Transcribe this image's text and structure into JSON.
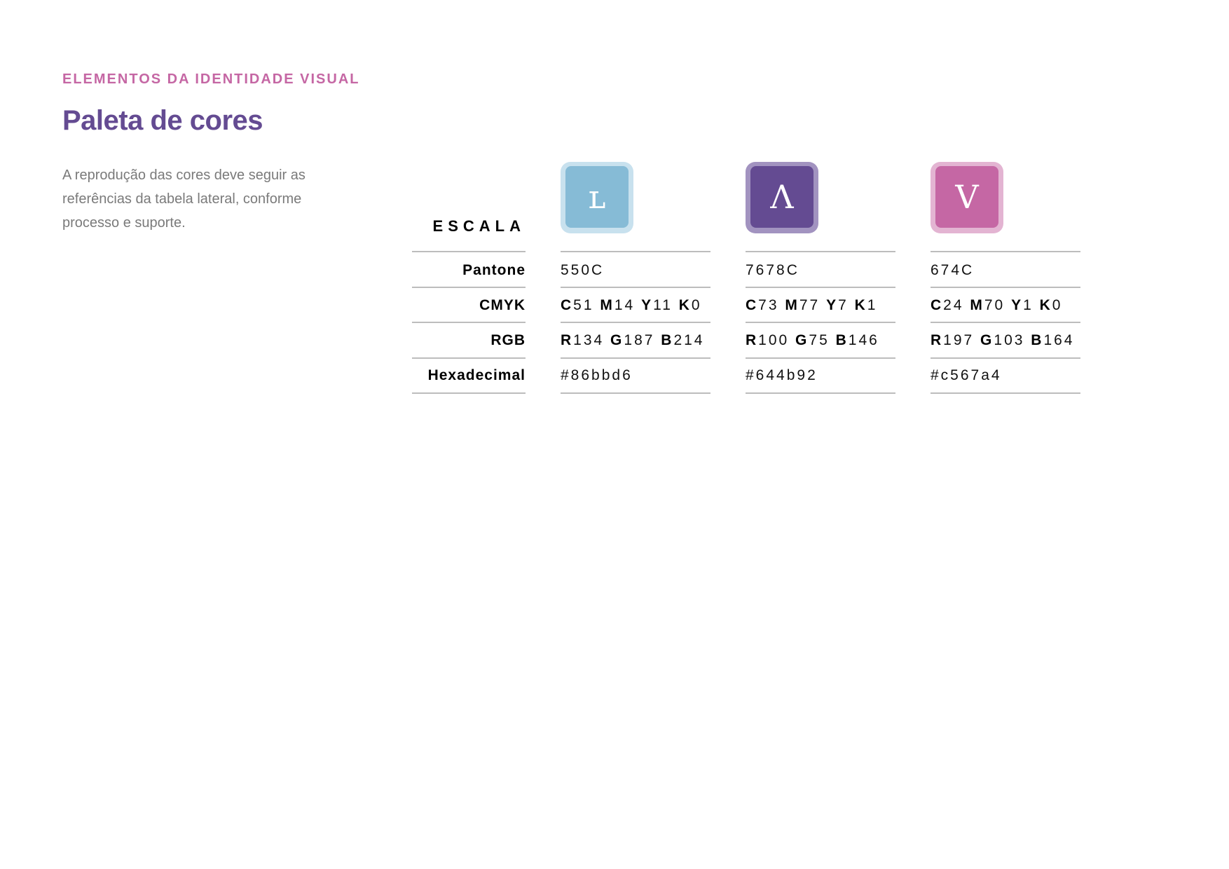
{
  "header": {
    "eyebrow": "ELEMENTOS DA IDENTIDADE VISUAL",
    "title": "Paleta de cores",
    "description": "A reprodução das cores deve seguir as referências da tabela lateral, conforme processo e suporte."
  },
  "table": {
    "scale_label": "ESCALA",
    "row_labels": {
      "pantone": "Pantone",
      "cmyk": "CMYK",
      "rgb": "RGB",
      "hex": "Hexadecimal"
    },
    "colors": [
      {
        "glyph": "ʟ",
        "swatch_color": "#86bbd6",
        "swatch_border": "#c8e1ee",
        "pantone": "550C",
        "cmyk": {
          "c": "51",
          "m": "14",
          "y": "11",
          "k": "0"
        },
        "rgb": {
          "r": "134",
          "g": "187",
          "b": "214"
        },
        "hex": "#86bbd6"
      },
      {
        "glyph": "Λ",
        "swatch_color": "#644b92",
        "swatch_border": "#a293c0",
        "pantone": "7678C",
        "cmyk": {
          "c": "73",
          "m": "77",
          "y": "7",
          "k": "1"
        },
        "rgb": {
          "r": "100",
          "g": "75",
          "b": "146"
        },
        "hex": "#644b92"
      },
      {
        "glyph": "V",
        "swatch_color": "#c567a4",
        "swatch_border": "#e3b4d2",
        "pantone": "674C",
        "cmyk": {
          "c": "24",
          "m": "70",
          "y": "1",
          "k": "0"
        },
        "rgb": {
          "r": "197",
          "g": "103",
          "b": "164"
        },
        "hex": "#c567a4"
      }
    ],
    "letters": {
      "c": "C",
      "m": "M",
      "y": "Y",
      "k": "K",
      "r": "R",
      "g": "G",
      "b": "B"
    }
  }
}
